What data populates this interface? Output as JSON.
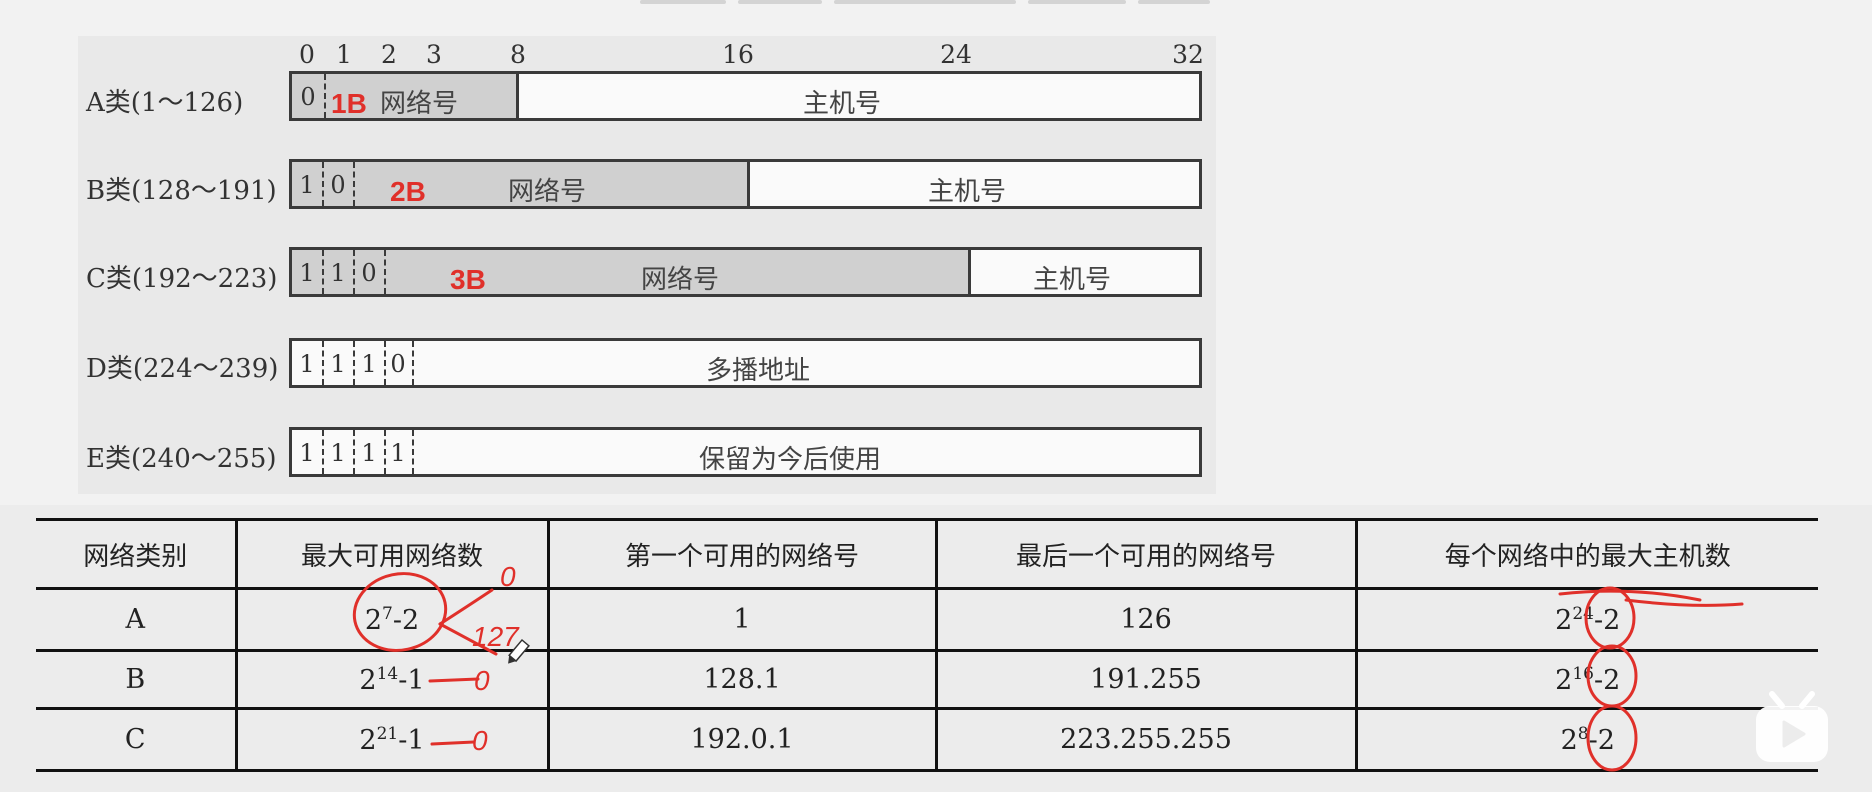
{
  "bit_positions": [
    "0",
    "1",
    "2",
    "3",
    "8",
    "16",
    "24",
    "32"
  ],
  "classes": [
    {
      "label": "A类(1～126)",
      "bits": [
        "0"
      ],
      "net": "网络号",
      "host": "主机号",
      "mark": "1B"
    },
    {
      "label": "B类(128～191)",
      "bits": [
        "1",
        "0"
      ],
      "net": "网络号",
      "host": "主机号",
      "mark": "2B"
    },
    {
      "label": "C类(192～223)",
      "bits": [
        "1",
        "1",
        "0"
      ],
      "net": "网络号",
      "host": "主机号",
      "mark": "3B"
    },
    {
      "label": "D类(224～239)",
      "bits": [
        "1",
        "1",
        "1",
        "0"
      ],
      "field": "多播地址"
    },
    {
      "label": "E类(240～255)",
      "bits": [
        "1",
        "1",
        "1",
        "1"
      ],
      "field": "保留为今后使用"
    }
  ],
  "table": {
    "headers": [
      "网络类别",
      "最大可用网络数",
      "第一个可用的网络号",
      "最后一个可用的网络号",
      "每个网络中的最大主机数"
    ],
    "rows": [
      {
        "cls": "A",
        "max_base": "2",
        "max_exp": "7",
        "max_tail": "-2",
        "first": "1",
        "last": "126",
        "host_base": "2",
        "host_exp": "24",
        "host_tail": "-2"
      },
      {
        "cls": "B",
        "max_base": "2",
        "max_exp": "14",
        "max_tail": "-1",
        "first": "128.1",
        "last": "191.255",
        "host_base": "2",
        "host_exp": "16",
        "host_tail": "-2"
      },
      {
        "cls": "C",
        "max_base": "2",
        "max_exp": "21",
        "max_tail": "-1",
        "first": "192.0.1",
        "last": "223.255.255",
        "host_base": "2",
        "host_exp": "8",
        "host_tail": "-2"
      }
    ]
  },
  "annotations": {
    "a_note1": "0",
    "a_note2": "127",
    "b_note": "0",
    "c_note": "0"
  },
  "colors": {
    "ink_red": "#e0302a",
    "network_fill": "#d0d0d0"
  },
  "icons": [
    "bilibili-logo-icon",
    "pencil-cursor-icon"
  ]
}
